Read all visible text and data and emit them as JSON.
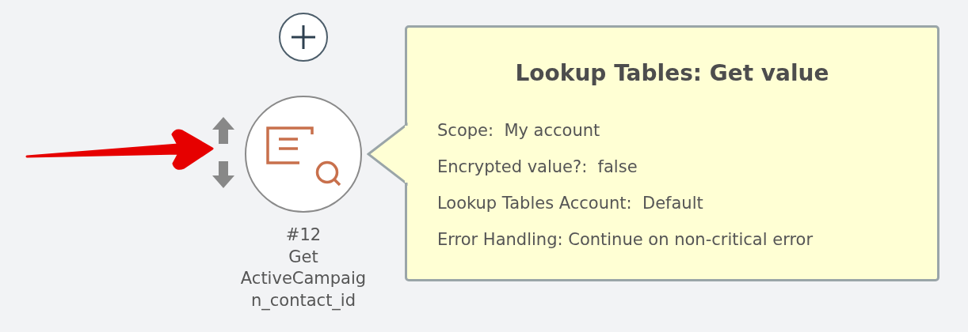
{
  "step": {
    "number": "#12",
    "name_lines": [
      "Get",
      "ActiveCampaig",
      "n_contact_id"
    ]
  },
  "tooltip": {
    "title": "Lookup Tables: Get value",
    "rows": [
      {
        "text": "Scope:  My account"
      },
      {
        "text": "Encrypted value?:  false"
      },
      {
        "text": "Lookup Tables Account:  Default"
      },
      {
        "text": "Error Handling: Continue on non-critical error"
      }
    ]
  }
}
